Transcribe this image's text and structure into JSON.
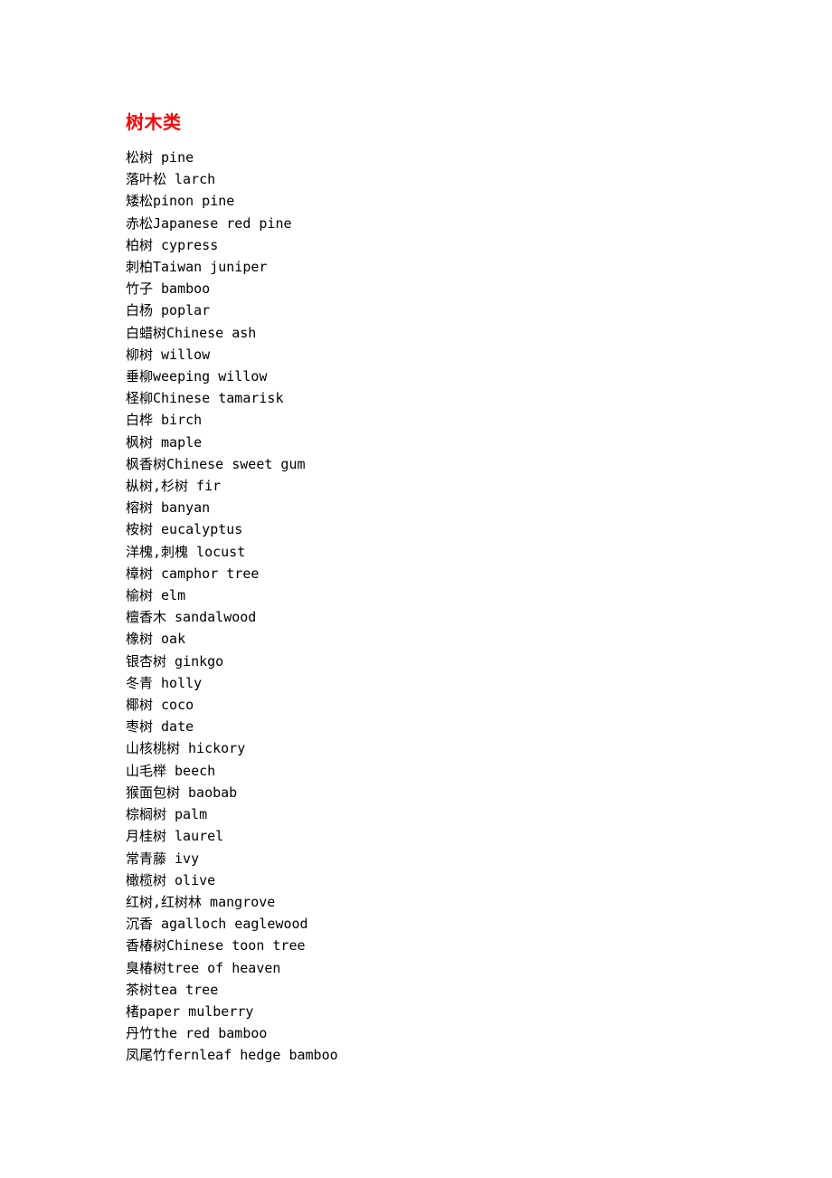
{
  "document": {
    "title": "树木类",
    "title_color": "#ff0000",
    "body_color": "#000000",
    "background_color": "#ffffff",
    "entries": [
      {
        "zh": "松树",
        "en": "pine",
        "line": "松树 pine"
      },
      {
        "zh": "落叶松",
        "en": "larch",
        "line": "落叶松 larch"
      },
      {
        "zh": "矮松",
        "en": "pinon pine",
        "line": "矮松pinon pine"
      },
      {
        "zh": "赤松",
        "en": "Japanese red pine",
        "line": "赤松Japanese red pine"
      },
      {
        "zh": "柏树",
        "en": "cypress",
        "line": "柏树 cypress"
      },
      {
        "zh": "刺柏",
        "en": "Taiwan juniper",
        "line": "刺柏Taiwan juniper"
      },
      {
        "zh": "竹子",
        "en": "bamboo",
        "line": "竹子 bamboo"
      },
      {
        "zh": "白杨",
        "en": "poplar",
        "line": "白杨 poplar"
      },
      {
        "zh": "白蜡树",
        "en": "Chinese ash",
        "line": "白蜡树Chinese ash"
      },
      {
        "zh": "柳树",
        "en": "willow",
        "line": "柳树 willow"
      },
      {
        "zh": "垂柳",
        "en": "weeping willow",
        "line": "垂柳weeping willow"
      },
      {
        "zh": "柽柳",
        "en": "Chinese tamarisk",
        "line": "柽柳Chinese tamarisk"
      },
      {
        "zh": "白桦",
        "en": "birch",
        "line": "白桦 birch"
      },
      {
        "zh": "枫树",
        "en": "maple",
        "line": "枫树 maple"
      },
      {
        "zh": "枫香树",
        "en": "Chinese sweet gum",
        "line": "枫香树Chinese sweet gum"
      },
      {
        "zh": "枞树,杉树",
        "en": "fir",
        "line": "枞树,杉树 fir"
      },
      {
        "zh": "榕树",
        "en": "banyan",
        "line": "榕树 banyan"
      },
      {
        "zh": "桉树",
        "en": "eucalyptus",
        "line": "桉树 eucalyptus"
      },
      {
        "zh": "洋槐,刺槐",
        "en": "locust",
        "line": "洋槐,刺槐 locust"
      },
      {
        "zh": "樟树",
        "en": "camphor tree",
        "line": "樟树 camphor tree"
      },
      {
        "zh": "榆树",
        "en": "elm",
        "line": "榆树 elm"
      },
      {
        "zh": "檀香木",
        "en": "sandalwood",
        "line": "檀香木 sandalwood"
      },
      {
        "zh": "橡树",
        "en": "oak",
        "line": "橡树 oak"
      },
      {
        "zh": "银杏树",
        "en": "ginkgo",
        "line": "银杏树 ginkgo"
      },
      {
        "zh": "冬青",
        "en": "holly",
        "line": "冬青 holly"
      },
      {
        "zh": "椰树",
        "en": "coco",
        "line": "椰树 coco"
      },
      {
        "zh": "枣树",
        "en": "date",
        "line": "枣树 date"
      },
      {
        "zh": "山核桃树",
        "en": "hickory",
        "line": "山核桃树 hickory"
      },
      {
        "zh": "山毛榉",
        "en": "beech",
        "line": "山毛榉 beech"
      },
      {
        "zh": "猴面包树",
        "en": "baobab",
        "line": "猴面包树 baobab"
      },
      {
        "zh": "棕榈树",
        "en": "palm",
        "line": "棕榈树 palm"
      },
      {
        "zh": "月桂树",
        "en": "laurel",
        "line": "月桂树 laurel"
      },
      {
        "zh": "常青藤",
        "en": "ivy",
        "line": "常青藤 ivy"
      },
      {
        "zh": "橄榄树",
        "en": "olive",
        "line": "橄榄树 olive"
      },
      {
        "zh": "红树,红树林",
        "en": "mangrove",
        "line": "红树,红树林 mangrove"
      },
      {
        "zh": "沉香",
        "en": "agalloch eaglewood",
        "line": "沉香 agalloch eaglewood"
      },
      {
        "zh": "香椿树",
        "en": "Chinese toon tree",
        "line": "香椿树Chinese toon tree"
      },
      {
        "zh": "臭椿树",
        "en": "tree of heaven",
        "line": "臭椿树tree of heaven"
      },
      {
        "zh": "茶树",
        "en": "tea tree",
        "line": "茶树tea tree"
      },
      {
        "zh": "楮",
        "en": "paper mulberry",
        "line": "楮paper mulberry"
      },
      {
        "zh": "丹竹",
        "en": "the red bamboo",
        "line": "丹竹the red bamboo"
      },
      {
        "zh": "凤尾竹",
        "en": "fernleaf hedge bamboo",
        "line": "凤尾竹fernleaf hedge bamboo"
      }
    ]
  }
}
